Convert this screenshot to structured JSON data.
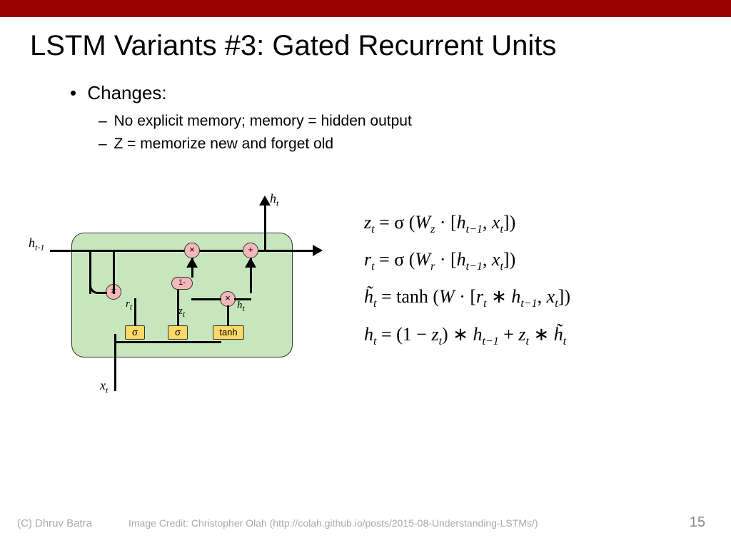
{
  "title": "LSTM Variants #3: Gated Recurrent Units",
  "bullets": {
    "main": "Changes:",
    "sub1": "No explicit memory; memory = hidden output",
    "sub2": "Z = memorize new and forget old"
  },
  "diagram": {
    "h_prev": "h",
    "h_prev_sub": "t-1",
    "h_out": "h",
    "h_out_sub": "t",
    "x_in": "x",
    "x_in_sub": "t",
    "r_lbl": "r",
    "r_sub": "t",
    "z_lbl": "z",
    "z_sub": "t",
    "htilde_lbl": "h̃",
    "htilde_sub": "t",
    "sigma1": "σ",
    "sigma2": "σ",
    "tanh": "tanh",
    "mul": "×",
    "plus": "+",
    "one_minus": "1-"
  },
  "equations": {
    "eq1_lhs_var": "z",
    "eq1_lhs_sub": "t",
    "eq1_rhs_part1": " = σ (",
    "eq1_W": "W",
    "eq1_Wsub": "z",
    "eq1_rhs_part2": " · [",
    "eq1_h": "h",
    "eq1_hsub": "t−1",
    "eq1_rhs_part3": ", ",
    "eq1_x": "x",
    "eq1_xsub": "t",
    "eq1_rhs_part4": "])",
    "eq2_lhs_var": "r",
    "eq2_lhs_sub": "t",
    "eq2_W": "W",
    "eq2_Wsub": "r",
    "eq3_lhs": "h̃",
    "eq3_lhs_sub": "t",
    "eq3_eq": " = tanh (",
    "eq3_W": "W",
    "eq3_mid": " · [",
    "eq3_r": "r",
    "eq3_rsub": "t",
    "eq3_star": " ∗ ",
    "eq3_h": "h",
    "eq3_hsub": "t−1",
    "eq3_mid2": ", ",
    "eq3_x": "x",
    "eq3_xsub": "t",
    "eq3_end": "])",
    "eq4_lhs": "h",
    "eq4_lhs_sub": "t",
    "eq4_p1": " = (1 − ",
    "eq4_z": "z",
    "eq4_zsub": "t",
    "eq4_p2": ") ∗ ",
    "eq4_h": "h",
    "eq4_hsub": "t−1",
    "eq4_p3": " + ",
    "eq4_z2": "z",
    "eq4_z2sub": "t",
    "eq4_p4": " ∗ ",
    "eq4_ht": "h̃",
    "eq4_htsub": "t"
  },
  "footer": {
    "copyright": "(C) Dhruv Batra",
    "credit": "Image Credit: Christopher Olah (http://colah.github.io/posts/2015-08-Understanding-LSTMs/)",
    "pagenum": "15"
  }
}
